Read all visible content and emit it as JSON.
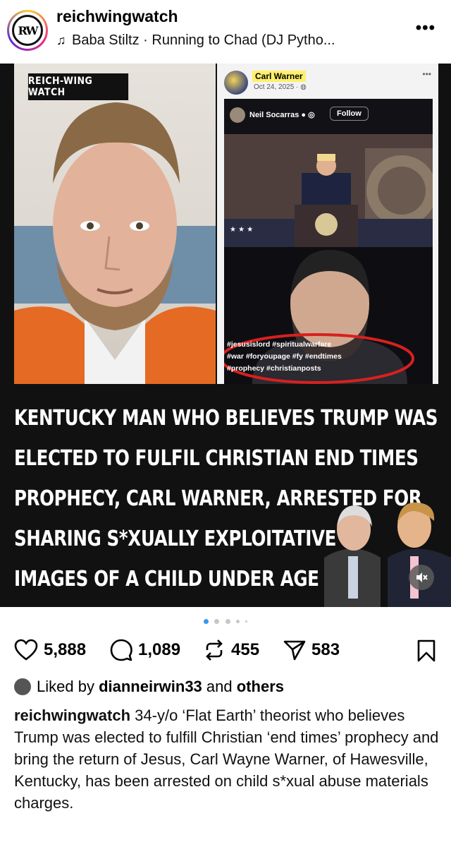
{
  "header": {
    "avatar_text": "RW",
    "username": "reichwingwatch",
    "music": "Baba Stiltz · Running to Chad (DJ Pytho...",
    "more_icon": "more-horizontal-icon"
  },
  "media": {
    "brand_label": "REICH-WING WATCH",
    "embedded_post": {
      "author": "Carl Warner",
      "date": "Oct 24, 2025 · ",
      "video_author": "Neil Socarras",
      "follow_label": "Follow",
      "hashtags": [
        "#jesusislord #spiritualwarfare",
        "#war #foryoupage #fy #endtimes",
        "#prophecy #christianposts"
      ]
    },
    "headline_lines": [
      "KENTUCKY MAN WHO BELIEVES TRUMP WAS",
      "ELECTED TO FULFIL CHRISTIAN END TIMES",
      "PROPHECY, CARL WARNER, ARRESTED FOR",
      "SHARING S*XUALLY EXPLOITATIVE",
      "IMAGES OF A CHILD UNDER AGE 12."
    ],
    "mute_icon": "volume-muted-icon"
  },
  "carousel": {
    "current": 1,
    "total": 5
  },
  "actions": {
    "likes": "5,888",
    "comments": "1,089",
    "reposts": "455",
    "shares": "583"
  },
  "liked_by": {
    "prefix": "Liked by",
    "user": "dianneirwin33",
    "joiner": "and",
    "suffix": "others"
  },
  "caption": {
    "username": "reichwingwatch",
    "text": "34-y/o ‘Flat Earth’ theorist who believes Trump was elected to fulfill Christian ‘end times’ prophecy and bring the return of Jesus, Carl Wayne Warner, of Hawesville, Kentucky, has been arrested on child s*xual abuse materials charges."
  },
  "colors": {
    "accent_dot": "#3897f0",
    "highlight": "#fff06a",
    "hashtag_circle": "#d8201f"
  }
}
